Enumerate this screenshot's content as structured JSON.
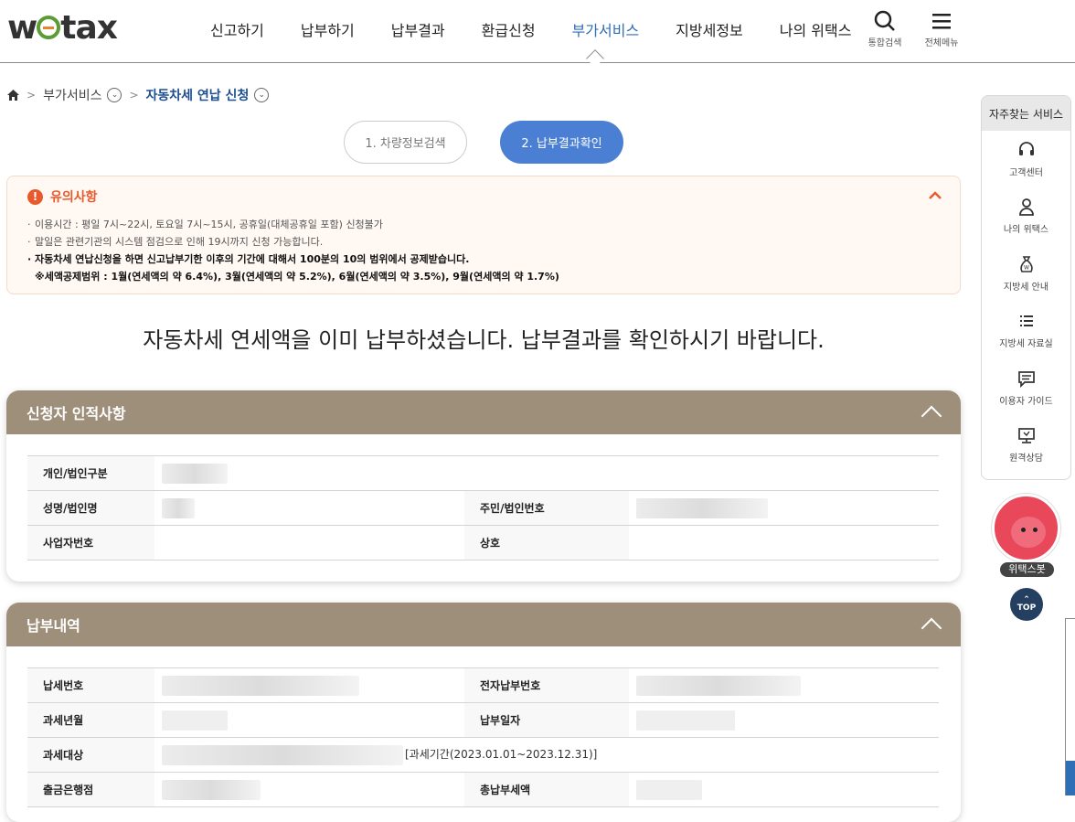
{
  "logo": {
    "text_before": "w",
    "text_after": "tax"
  },
  "nav": {
    "items": [
      "신고하기",
      "납부하기",
      "납부결과",
      "환급신청",
      "부가서비스",
      "지방세정보",
      "나의 위택스"
    ],
    "active_index": 4
  },
  "header_icons": {
    "search_label": "통합검색",
    "menu_label": "전체메뉴"
  },
  "breadcrumb": {
    "level1": "부가서비스",
    "current": "자동차세 연납 신청"
  },
  "steps": {
    "step1": "1. 차량정보검색",
    "step2": "2. 납부결과확인",
    "active": 2
  },
  "notice": {
    "title": "유의사항",
    "items": [
      "이용시간 : 평일 7시~22시, 토요일 7시~15시, 공휴일(대체공휴일 포함) 신청불가",
      "말일은 관련기관의 시스템 점검으로 인해 19시까지 신청 가능합니다.",
      "자동차세 연납신청을 하면 신고납부기한 이후의 기간에 대해서 100분의 10의 범위에서 공제받습니다."
    ],
    "sub_note": "※세액공제범위 : 1월(연세액의 약 6.4%), 3월(연세액의 약 5.2%), 6월(연세액의 약 3.5%), 9월(연세액의 약 1.7%)"
  },
  "message": "자동차세 연세액을 이미 납부하셨습니다. 납부결과를 확인하시기 바랍니다.",
  "applicant": {
    "title": "신청자 인적사항",
    "labels": {
      "type": "개인/법인구분",
      "name": "성명/법인명",
      "id_number": "주민/법인번호",
      "business_number": "사업자번호",
      "company": "상호"
    }
  },
  "payment": {
    "title": "납부내역",
    "labels": {
      "tax_number": "납세번호",
      "e_payment_number": "전자납부번호",
      "tax_year_month": "과세년월",
      "payment_date": "납부일자",
      "tax_object": "과세대상",
      "bank": "출금은행점",
      "total_amount": "총납부세액"
    },
    "tax_period": "[과세기간(2023.01.01~2023.12.31)]"
  },
  "sidebar": {
    "title": "자주찾는 서비스",
    "items": [
      {
        "label": "고객센터",
        "icon": "headset-icon"
      },
      {
        "label": "나의 위택스",
        "icon": "user-icon"
      },
      {
        "label": "지방세 안내",
        "icon": "won-bag-icon"
      },
      {
        "label": "지방세 자료실",
        "icon": "list-icon"
      },
      {
        "label": "이용자 가이드",
        "icon": "chat-icon"
      },
      {
        "label": "원격상담",
        "icon": "monitor-icon"
      }
    ]
  },
  "chatbot": {
    "label": "위택스봇"
  },
  "top_button": {
    "label": "TOP"
  },
  "colors": {
    "accent": "#2f6fb6",
    "panel_header": "#9e8f7b",
    "warning": "#e8592b",
    "step_active": "#4a7fd4"
  }
}
